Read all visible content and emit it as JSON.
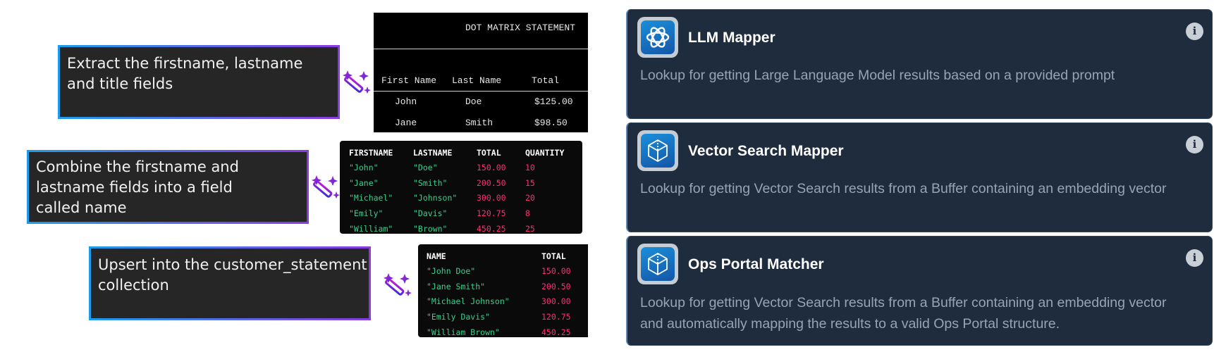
{
  "steps": [
    {
      "prompt_lines": [
        "Extract the firstname, lastname",
        "and title fields"
      ]
    },
    {
      "prompt_lines": [
        "Combine the firstname and",
        "lastname fields into a field",
        "called name"
      ]
    },
    {
      "prompt_lines": [
        "Upsert into the customer_statement",
        "collection"
      ]
    }
  ],
  "dot_matrix": {
    "title": "DOT MATRIX STATEMENT",
    "headers": [
      "First Name",
      "Last Name",
      "Total"
    ],
    "rows": [
      [
        "John",
        "Doe",
        "$125.00"
      ],
      [
        "Jane",
        "Smith",
        "$98.50"
      ]
    ]
  },
  "table_combined": {
    "headers": [
      "FIRSTNAME",
      "LASTNAME",
      "TOTAL",
      "QUANTITY"
    ],
    "rows": [
      [
        "\"John\"",
        "\"Doe\"",
        "150.00",
        "10"
      ],
      [
        "\"Jane\"",
        "\"Smith\"",
        "200.50",
        "15"
      ],
      [
        "\"Michael\"",
        "\"Johnson\"",
        "300.00",
        "20"
      ],
      [
        "\"Emily\"",
        "\"Davis\"",
        "120.75",
        "8"
      ],
      [
        "\"William\"",
        "\"Brown\"",
        "450.25",
        "25"
      ]
    ]
  },
  "table_named": {
    "headers": [
      "NAME",
      "TOTAL"
    ],
    "rows": [
      [
        "\"John Doe\"",
        "150.00"
      ],
      [
        "\"Jane Smith\"",
        "200.50"
      ],
      [
        "\"Michael Johnson\"",
        "300.00"
      ],
      [
        "\"Emily Davis\"",
        "120.75"
      ],
      [
        "\"William Brown\"",
        "450.25"
      ]
    ]
  },
  "cards": [
    {
      "title": "LLM Mapper",
      "icon": "openai-logo-icon",
      "description": [
        "Lookup for getting Large Language Model results based on a provided prompt"
      ]
    },
    {
      "title": "Vector Search Mapper",
      "icon": "vector-cube-icon",
      "description": [
        "Lookup for getting Vector Search results from a Buffer containing an embedding vector"
      ]
    },
    {
      "title": "Ops Portal Matcher",
      "icon": "vector-cube-icon",
      "description": [
        "Lookup for getting Vector Search results from a Buffer containing an embedding vector",
        "and automatically mapping the results to a valid Ops Portal structure."
      ]
    }
  ],
  "info_glyph": "i",
  "colors": {
    "string": "#3ccf8e",
    "number": "#ff2d78",
    "card_bg": "#1f2c3e",
    "gradient_start": "#1e9bea",
    "gradient_end": "#8a3be0"
  }
}
